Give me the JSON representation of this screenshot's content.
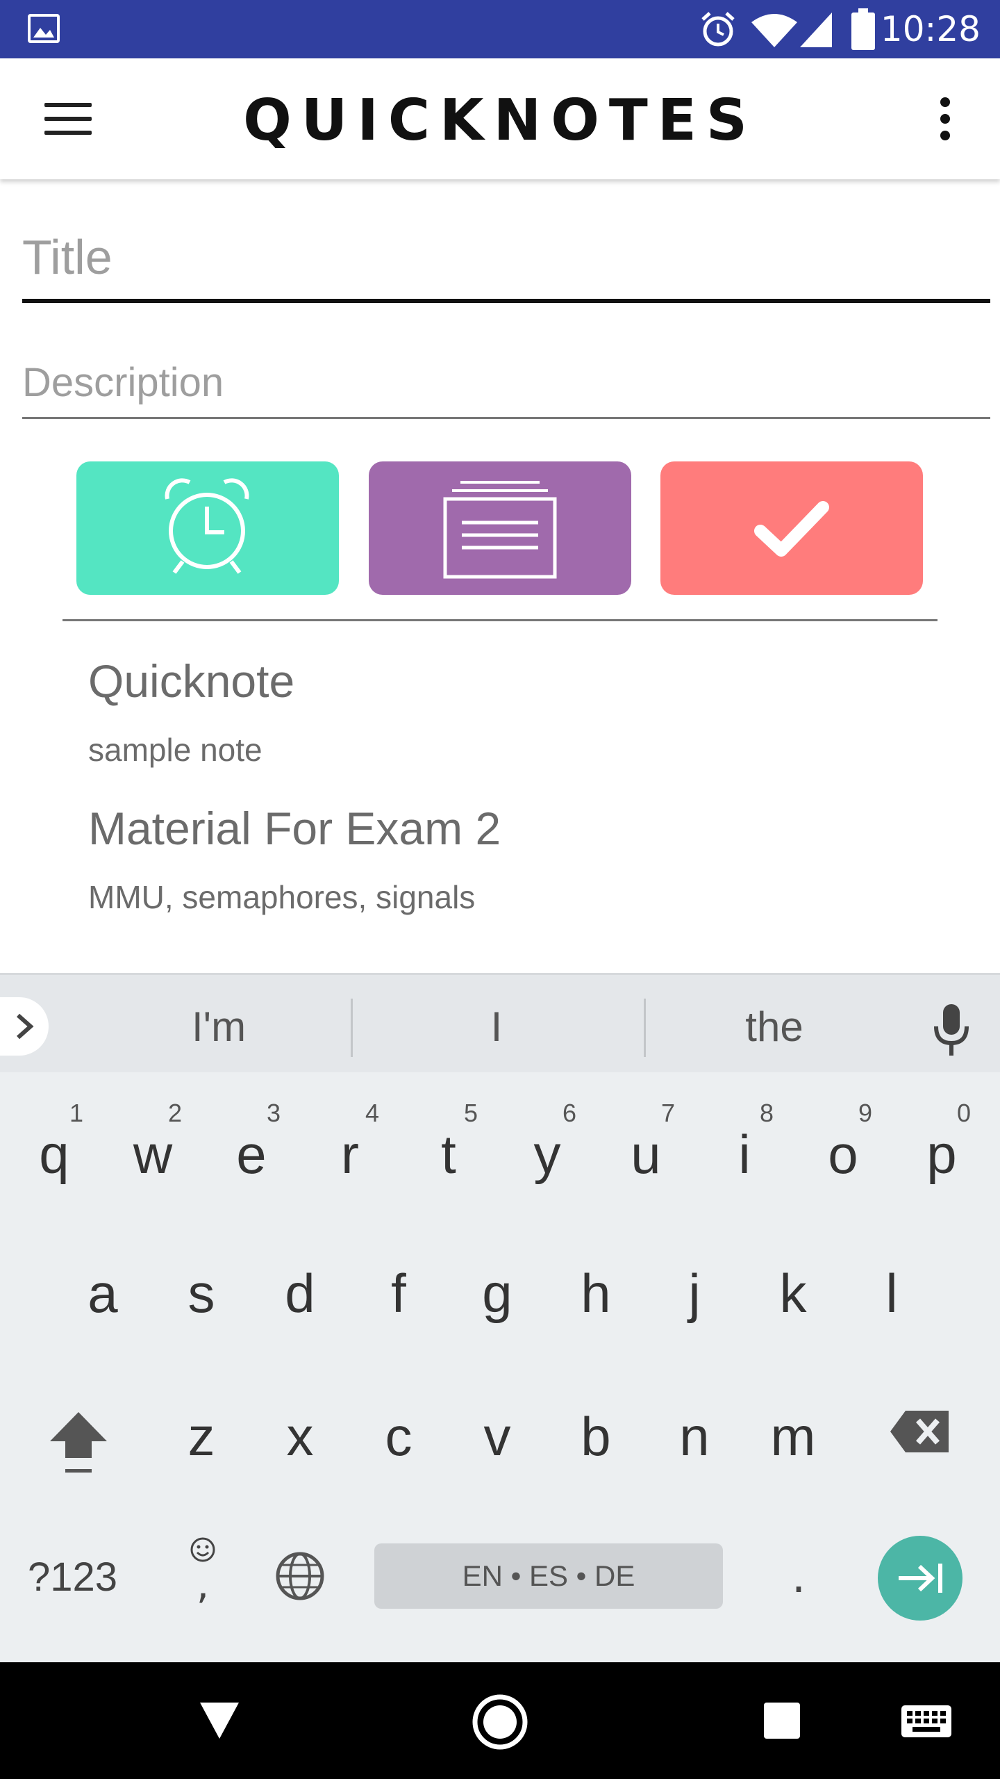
{
  "status_bar": {
    "time": "10:28",
    "icons": [
      "image-icon",
      "alarm-icon",
      "wifi-icon",
      "signal-icon",
      "battery-icon"
    ]
  },
  "app_bar": {
    "title": "QUICKNOTES",
    "icons": [
      "menu-icon",
      "overflow-icon"
    ]
  },
  "form": {
    "title_placeholder": "Title",
    "title_value": "",
    "description_placeholder": "Description",
    "description_value": ""
  },
  "actions": [
    {
      "icon": "alarm-clock-icon",
      "color": "#54e5c2"
    },
    {
      "icon": "notes-stack-icon",
      "color": "#a06aac"
    },
    {
      "icon": "checkmark-icon",
      "color": "#ff7c7c"
    }
  ],
  "notes": [
    {
      "title": "Quicknote",
      "description": "sample note"
    },
    {
      "title": "Material For Exam 2",
      "description": "MMU, semaphores, signals"
    }
  ],
  "keyboard": {
    "suggestions": [
      "I'm",
      "I",
      "the"
    ],
    "row1": [
      {
        "ch": "q",
        "num": "1"
      },
      {
        "ch": "w",
        "num": "2"
      },
      {
        "ch": "e",
        "num": "3"
      },
      {
        "ch": "r",
        "num": "4"
      },
      {
        "ch": "t",
        "num": "5"
      },
      {
        "ch": "y",
        "num": "6"
      },
      {
        "ch": "u",
        "num": "7"
      },
      {
        "ch": "i",
        "num": "8"
      },
      {
        "ch": "o",
        "num": "9"
      },
      {
        "ch": "p",
        "num": "0"
      }
    ],
    "row2": [
      "a",
      "s",
      "d",
      "f",
      "g",
      "h",
      "j",
      "k",
      "l"
    ],
    "row3": [
      "z",
      "x",
      "c",
      "v",
      "b",
      "n",
      "m"
    ],
    "symbols_label": "?123",
    "comma_label": ",",
    "space_label": "EN • ES • DE",
    "period_label": ".",
    "accent_color": "#4cb6a6"
  },
  "nav_bar": {
    "icons": [
      "back-icon",
      "home-icon",
      "recents-icon",
      "keyboard-switch-icon"
    ]
  }
}
